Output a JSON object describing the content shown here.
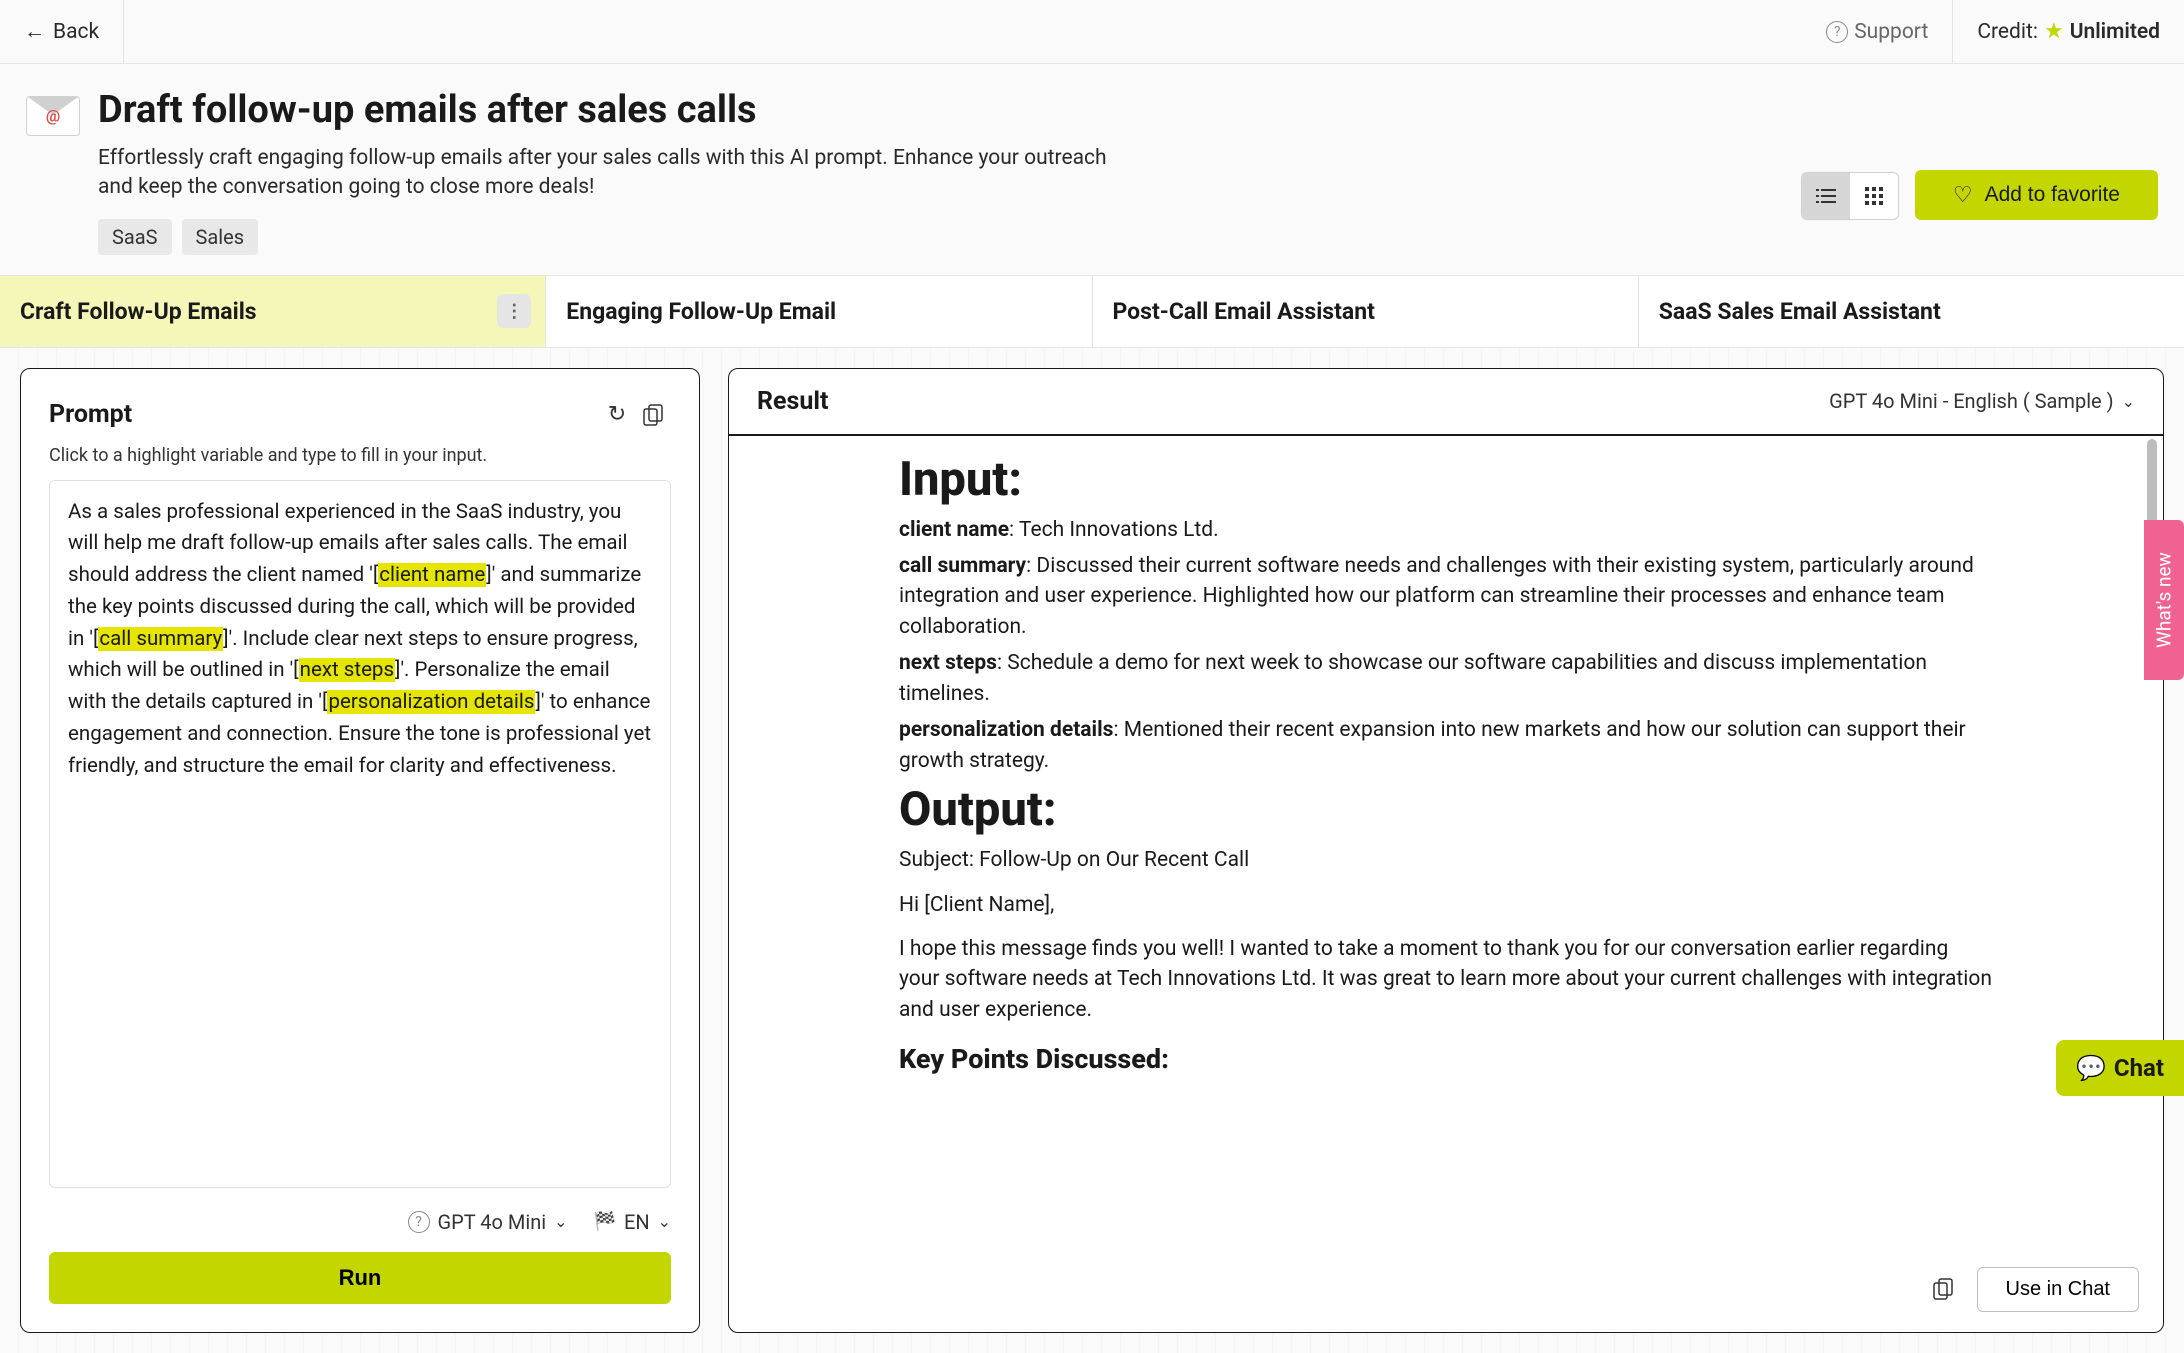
{
  "topbar": {
    "back": "Back",
    "support": "Support",
    "credit_label": "Credit:",
    "credit_value": "Unlimited"
  },
  "header": {
    "title": "Draft follow-up emails after sales calls",
    "subtitle": "Effortlessly craft engaging follow-up emails after your sales calls with this AI prompt. Enhance your outreach and keep the conversation going to close more deals!",
    "tags": [
      "SaaS",
      "Sales"
    ],
    "favorite_label": "Add to favorite"
  },
  "tabs": [
    {
      "label": "Craft Follow-Up Emails",
      "active": true
    },
    {
      "label": "Engaging Follow-Up Email",
      "active": false
    },
    {
      "label": "Post-Call Email Assistant",
      "active": false
    },
    {
      "label": "SaaS Sales Email Assistant",
      "active": false
    }
  ],
  "prompt": {
    "title": "Prompt",
    "helper": "Click to a highlight variable and type to fill in your input.",
    "text_parts": {
      "p1": "As a sales professional experienced in the SaaS industry, you will help me draft follow-up emails after sales calls. The email should address the client named '[",
      "v1": "client name",
      "p2": "]' and summarize the key points discussed during the call, which will be provided in '[",
      "v2": "call summary",
      "p3": "]'. Include clear next steps to ensure progress, which will be outlined in '[",
      "v3": "next steps",
      "p4": "]'. Personalize the email with the details captured in '[",
      "v4": "personalization details",
      "p5": "]' to enhance engagement and connection. Ensure the tone is professional yet friendly, and structure the email for clarity and effectiveness."
    },
    "model": "GPT 4o Mini",
    "lang": "EN",
    "run_label": "Run"
  },
  "result": {
    "title": "Result",
    "selector": "GPT 4o Mini - English ( Sample )",
    "input_heading": "Input:",
    "input": {
      "client_name_label": "client name",
      "client_name_value": ": Tech Innovations Ltd.",
      "call_summary_label": "call summary",
      "call_summary_value": ": Discussed their current software needs and challenges with their existing system, particularly around integration and user experience. Highlighted how our platform can streamline their processes and enhance team collaboration.",
      "next_steps_label": "next steps",
      "next_steps_value": ": Schedule a demo for next week to showcase our software capabilities and discuss implementation timelines.",
      "personalization_label": "personalization details",
      "personalization_value": ": Mentioned their recent expansion into new markets and how our solution can support their growth strategy."
    },
    "output_heading": "Output:",
    "output": {
      "subject": "Subject: Follow-Up on Our Recent Call",
      "greeting": "Hi [Client Name],",
      "body1": "I hope this message finds you well! I wanted to take a moment to thank you for our conversation earlier regarding your software needs at Tech Innovations Ltd. It was great to learn more about your current challenges with integration and user experience.",
      "sub1": "Key Points Discussed:"
    },
    "use_in_chat": "Use in Chat"
  },
  "sidebar": {
    "whatsnew": "What's new",
    "chat": "Chat"
  }
}
